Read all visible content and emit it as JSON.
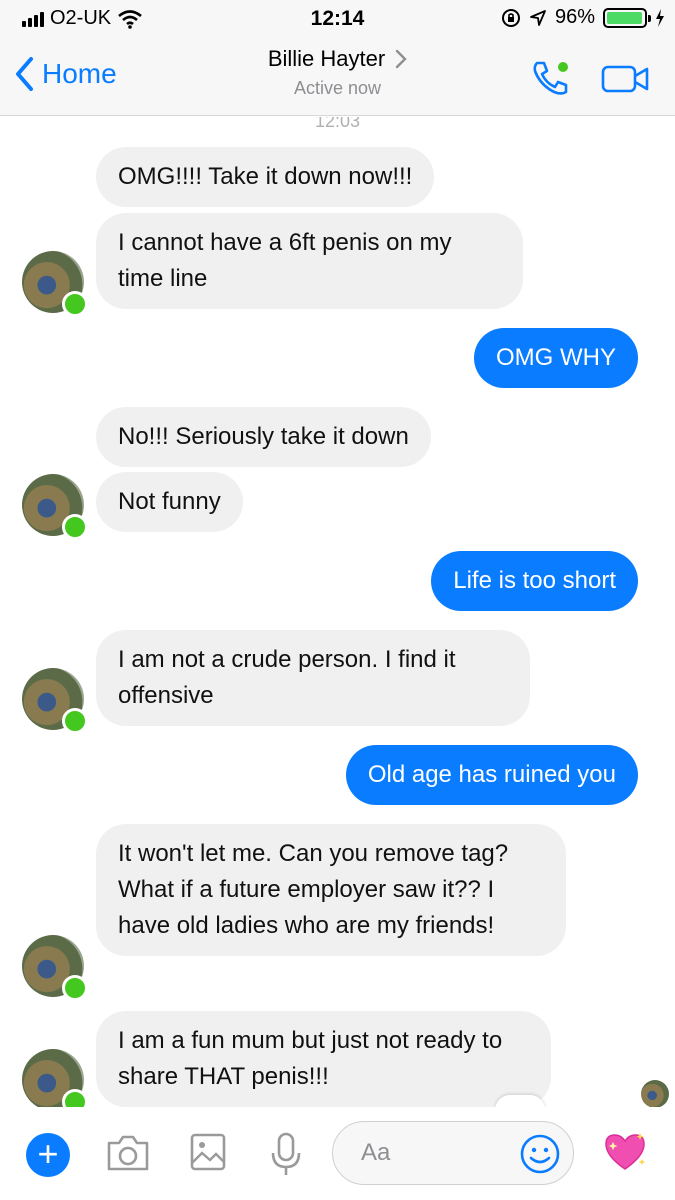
{
  "status_bar": {
    "carrier": "O2-UK",
    "time": "12:14",
    "battery": "96%",
    "battery_level": 0.96
  },
  "header": {
    "back_label": "Home",
    "contact_name": "Billie Hayter",
    "status": "Active now"
  },
  "chat": {
    "timestamp": "12:03",
    "messages": [
      {
        "side": "in",
        "text": "OMG!!!! Take it down now!!!"
      },
      {
        "side": "in",
        "text": "I cannot have a 6ft penis on my time line"
      },
      {
        "side": "out",
        "text": "OMG WHY"
      },
      {
        "side": "in",
        "text": "No!!! Seriously take it down"
      },
      {
        "side": "in",
        "text": "Not funny"
      },
      {
        "side": "out",
        "text": "Life is too short"
      },
      {
        "side": "in",
        "text": "I am not a crude person. I find it offensive"
      },
      {
        "side": "out",
        "text": "Old age has ruined you"
      },
      {
        "side": "in",
        "text": "It won't let me. Can you remove tag? What if a future employer saw it?? I have old ladies who are my friends!"
      },
      {
        "side": "in",
        "text": "I am a fun mum but just not ready to share THAT penis!!!"
      }
    ]
  },
  "composer": {
    "placeholder": "Aa"
  },
  "colors": {
    "accent": "#0a7cff",
    "incoming_bubble": "#f0f0f0",
    "online": "#44c81f"
  }
}
